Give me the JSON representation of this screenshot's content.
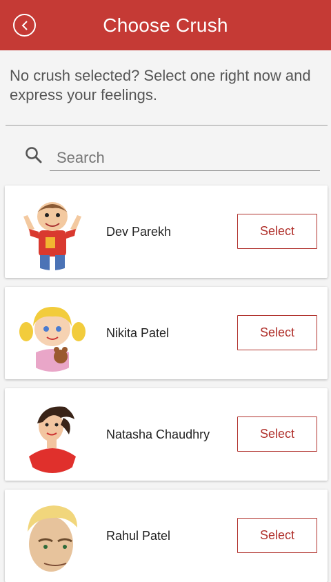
{
  "header": {
    "title": "Choose Crush",
    "back_icon": "chevron-left-circle-icon"
  },
  "intro_text": "No crush selected? Select one right now and express your feelings.",
  "search": {
    "placeholder": "Search",
    "value": ""
  },
  "colors": {
    "accent": "#c53a35",
    "button_text": "#b0302b",
    "background": "#f4f4f4"
  },
  "contacts": [
    {
      "name": "Dev Parekh",
      "button_label": "Select",
      "avatar": "cartoon-boy-red-shirt"
    },
    {
      "name": "Nikita Patel",
      "button_label": "Select",
      "avatar": "cartoon-girl-blonde-teddy"
    },
    {
      "name": "Natasha Chaudhry",
      "button_label": "Select",
      "avatar": "cartoon-woman-red-top"
    },
    {
      "name": "Rahul Patel",
      "button_label": "Select",
      "avatar": "cartoon-man-blonde"
    }
  ]
}
